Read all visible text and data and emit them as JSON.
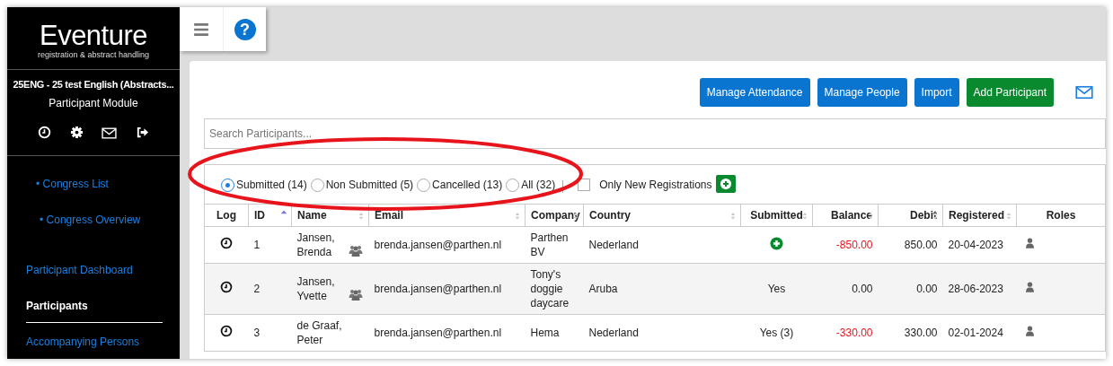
{
  "sidebar": {
    "logo": "Eventure",
    "tagline": "registration & abstract handling",
    "congress": "25ENG - 25 test English (Abstracts...",
    "module": "Participant Module",
    "nav": [
      {
        "label": "• Congress List",
        "kind": "sub",
        "selected": false
      },
      {
        "label": "• Congress Overview",
        "kind": "subsub",
        "selected": false
      },
      {
        "label": "Participant Dashboard",
        "kind": "main",
        "selected": false
      },
      {
        "label": "Participants",
        "kind": "main",
        "selected": true
      },
      {
        "label": "Accompanying Persons",
        "kind": "main",
        "selected": false
      }
    ]
  },
  "topbar": {
    "help_glyph": "?"
  },
  "actions": [
    {
      "label": "Manage Attendance",
      "kind": "primary"
    },
    {
      "label": "Manage People",
      "kind": "primary"
    },
    {
      "label": "Import",
      "kind": "primary"
    },
    {
      "label": "Add Participant",
      "kind": "success"
    }
  ],
  "search": {
    "placeholder": "Search Participants..."
  },
  "filters": [
    {
      "label": "Submitted (14)",
      "selected": true
    },
    {
      "label": "Non Submitted (5)",
      "selected": false
    },
    {
      "label": "Cancelled (13)",
      "selected": false
    },
    {
      "label": "All (32)",
      "selected": false
    }
  ],
  "only_new": {
    "label": "Only New Registrations",
    "checked": false
  },
  "table": {
    "columns": [
      {
        "label": "Log",
        "sortable": false
      },
      {
        "label": "ID",
        "sortable": true,
        "sorted": true
      },
      {
        "label": "Name",
        "sortable": true,
        "sorted": false
      },
      {
        "label": "Email",
        "sortable": true,
        "sorted": false
      },
      {
        "label": "Company",
        "sortable": true,
        "sorted": false
      },
      {
        "label": "Country",
        "sortable": true,
        "sorted": false
      },
      {
        "label": "Submitted",
        "sortable": true,
        "sorted": false
      },
      {
        "label": "Balance",
        "sortable": true,
        "sorted": false
      },
      {
        "label": "Debit",
        "sortable": true,
        "sorted": false
      },
      {
        "label": "Registered",
        "sortable": true,
        "sorted": false
      },
      {
        "label": "Roles",
        "sortable": false
      }
    ],
    "rows": [
      {
        "id": "1",
        "name": "Jansen, Brenda",
        "group": true,
        "email": "brenda.jansen@parthen.nl",
        "company": "Parthen BV",
        "country": "Nederland",
        "kind": "add",
        "balance": "-850.00",
        "negative": true,
        "debit": "850.00",
        "registered": "20-04-2023"
      },
      {
        "id": "2",
        "name": "Jansen, Yvette",
        "group": true,
        "email": "brenda.jansen@parthen.nl",
        "company": "Tony's doggie daycare",
        "country": "Aruba",
        "kind": "text",
        "submitted": "Yes",
        "balance": "0.00",
        "negative": false,
        "debit": "0.00",
        "registered": "28-06-2023"
      },
      {
        "id": "3",
        "name": "de Graaf, Peter",
        "group": false,
        "email": "brenda.jansen@parthen.nl",
        "company": "Hema",
        "country": "Nederland",
        "kind": "text",
        "submitted": "Yes (3)",
        "balance": "-330.00",
        "negative": true,
        "debit": "330.00",
        "registered": "02-01-2024"
      }
    ]
  }
}
